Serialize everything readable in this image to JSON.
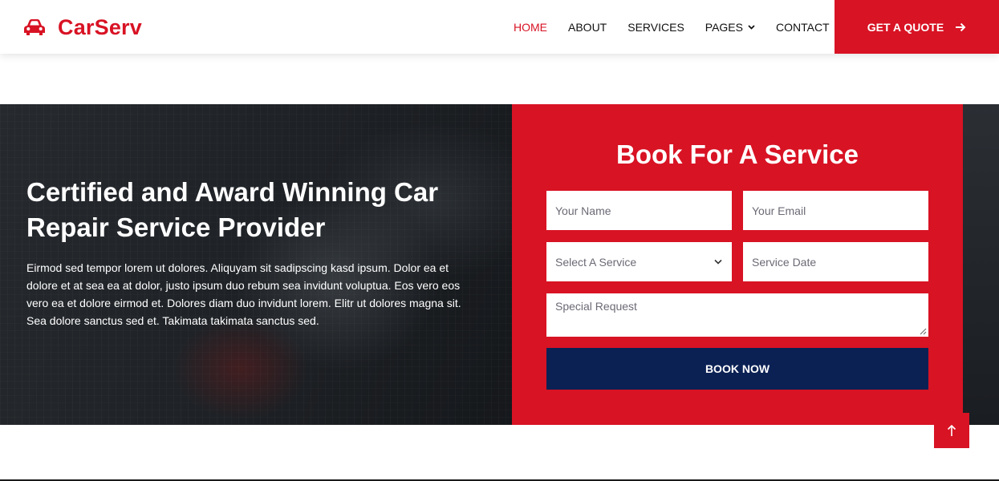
{
  "brand": {
    "name": "CarServ",
    "icon": "car-icon"
  },
  "nav": {
    "items": [
      {
        "label": "HOME",
        "active": true
      },
      {
        "label": "ABOUT",
        "active": false
      },
      {
        "label": "SERVICES",
        "active": false
      },
      {
        "label": "PAGES",
        "active": false,
        "dropdown": true
      },
      {
        "label": "CONTACT",
        "active": false
      }
    ],
    "quote_button": "GET A QUOTE"
  },
  "hero": {
    "title": "Certified and Award Winning Car Repair Service Provider",
    "text": "Eirmod sed tempor lorem ut dolores. Aliquyam sit sadipscing kasd ipsum. Dolor ea et dolore et at sea ea at dolor, justo ipsum duo rebum sea invidunt voluptua. Eos vero eos vero ea et dolore eirmod et. Dolores diam duo invidunt lorem. Elitr ut dolores magna sit. Sea dolore sanctus sed et. Takimata takimata sanctus sed."
  },
  "booking": {
    "title": "Book For A Service",
    "name_placeholder": "Your Name",
    "email_placeholder": "Your Email",
    "service_select": "Select A Service",
    "date_placeholder": "Service Date",
    "request_placeholder": "Special Request",
    "submit": "BOOK NOW"
  },
  "colors": {
    "primary": "#D81324",
    "secondary": "#0B2154"
  },
  "back_to_top_icon": "arrow-up-icon"
}
